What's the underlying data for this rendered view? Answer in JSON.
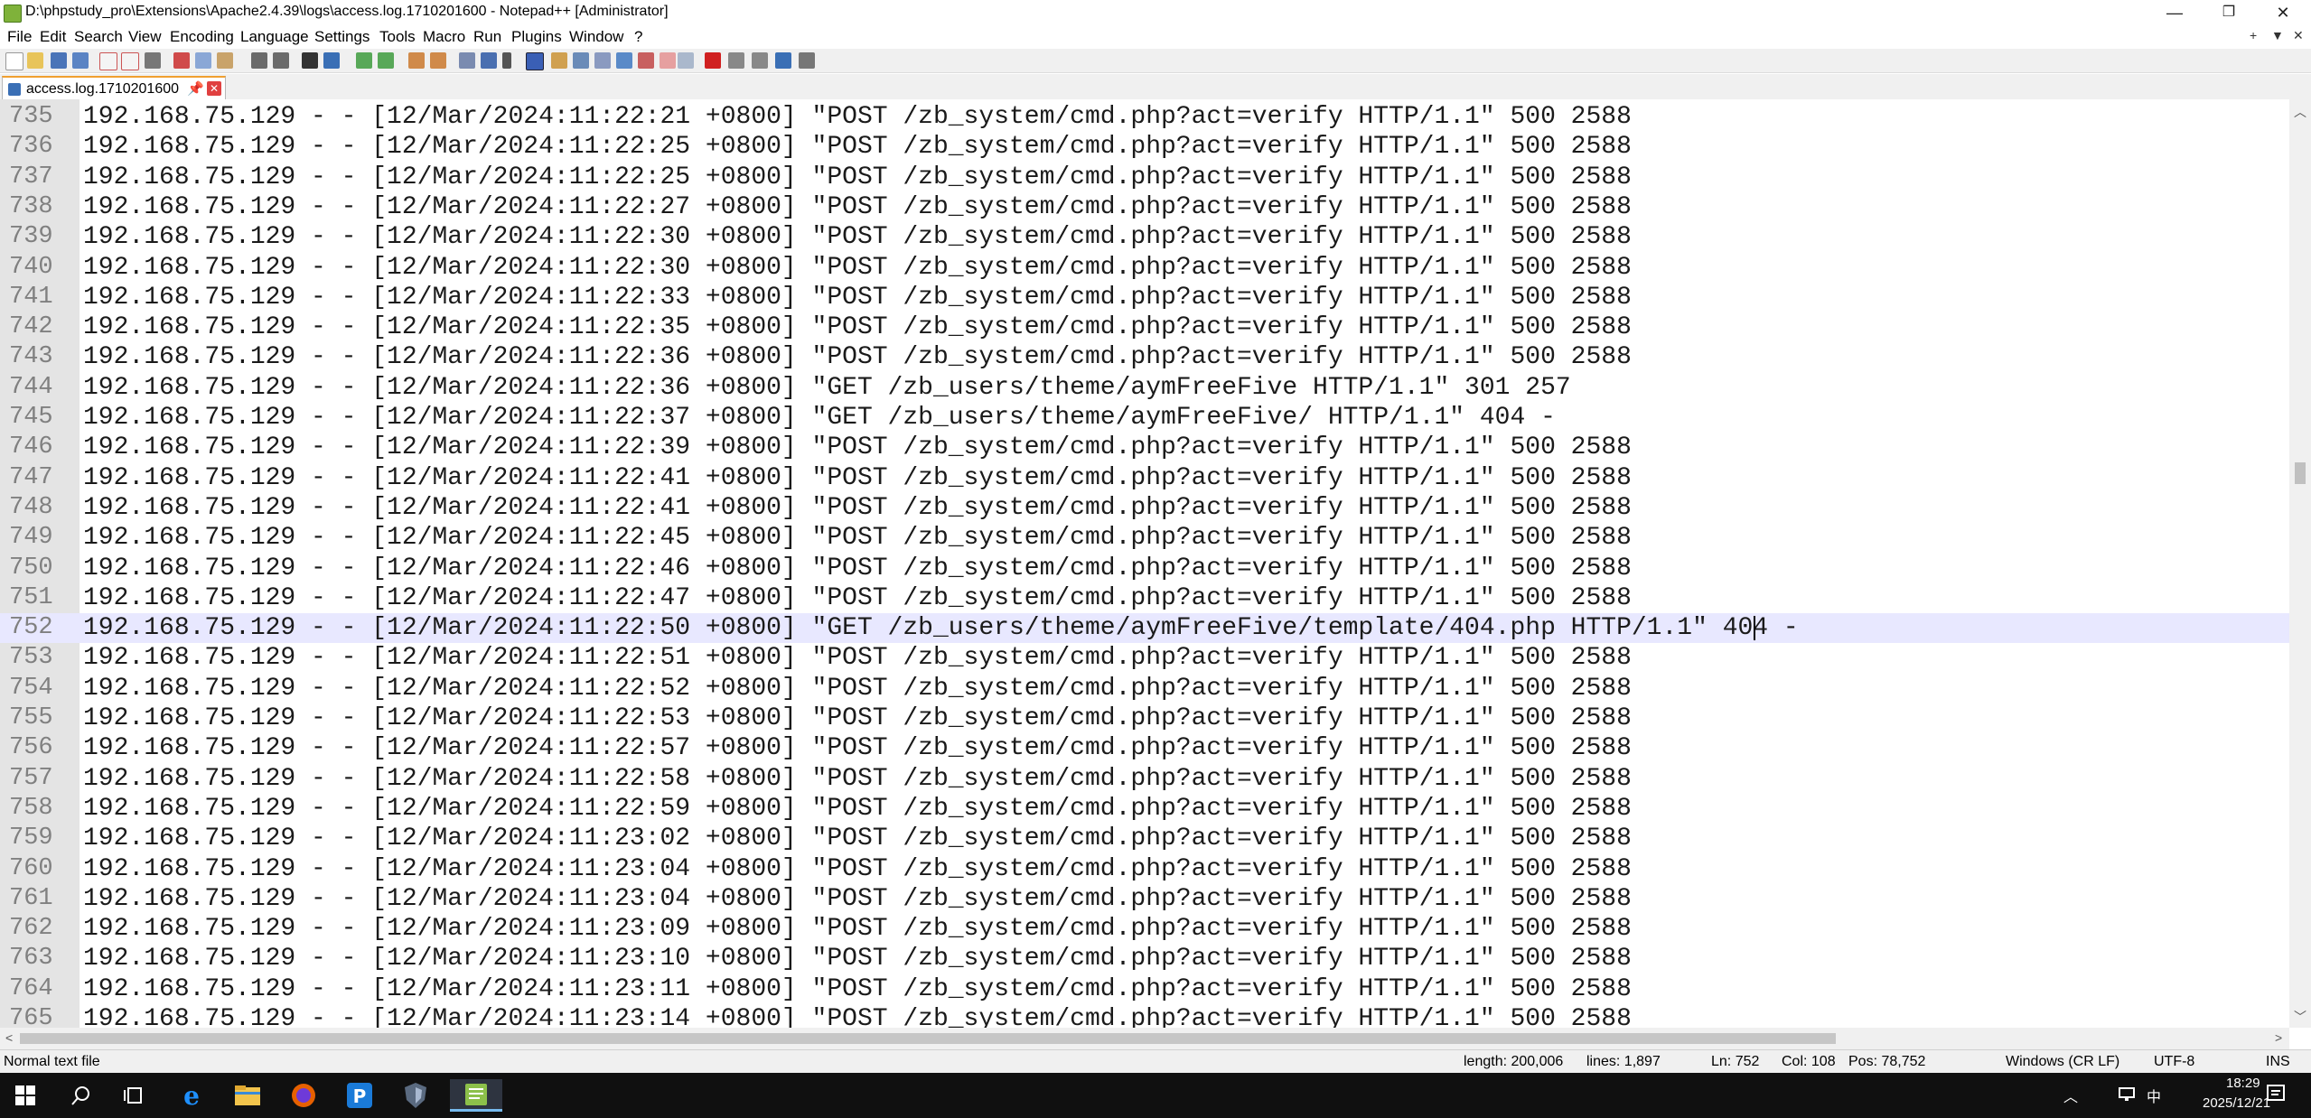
{
  "window": {
    "title": "D:\\phpstudy_pro\\Extensions\\Apache2.4.39\\logs\\access.log.1710201600 - Notepad++ [Administrator]",
    "minimize_glyph": "—",
    "maximize_glyph": "❐",
    "close_glyph": "✕"
  },
  "menu": {
    "items": [
      "File",
      "Edit",
      "Search",
      "View",
      "Encoding",
      "Language",
      "Settings",
      "Tools",
      "Macro",
      "Run",
      "Plugins",
      "Window",
      "?"
    ],
    "right_plus": "+",
    "right_dropdown": "▼",
    "right_close": "✕"
  },
  "tab": {
    "label": "access.log.1710201600",
    "pin_glyph": "📌",
    "close_glyph": "✕"
  },
  "editor": {
    "current_line": 752,
    "lines": [
      {
        "num": "735",
        "text": "192.168.75.129 - - [12/Mar/2024:11:22:21 +0800] \"POST /zb_system/cmd.php?act=verify HTTP/1.1\" 500 2588"
      },
      {
        "num": "736",
        "text": "192.168.75.129 - - [12/Mar/2024:11:22:25 +0800] \"POST /zb_system/cmd.php?act=verify HTTP/1.1\" 500 2588"
      },
      {
        "num": "737",
        "text": "192.168.75.129 - - [12/Mar/2024:11:22:25 +0800] \"POST /zb_system/cmd.php?act=verify HTTP/1.1\" 500 2588"
      },
      {
        "num": "738",
        "text": "192.168.75.129 - - [12/Mar/2024:11:22:27 +0800] \"POST /zb_system/cmd.php?act=verify HTTP/1.1\" 500 2588"
      },
      {
        "num": "739",
        "text": "192.168.75.129 - - [12/Mar/2024:11:22:30 +0800] \"POST /zb_system/cmd.php?act=verify HTTP/1.1\" 500 2588"
      },
      {
        "num": "740",
        "text": "192.168.75.129 - - [12/Mar/2024:11:22:30 +0800] \"POST /zb_system/cmd.php?act=verify HTTP/1.1\" 500 2588"
      },
      {
        "num": "741",
        "text": "192.168.75.129 - - [12/Mar/2024:11:22:33 +0800] \"POST /zb_system/cmd.php?act=verify HTTP/1.1\" 500 2588"
      },
      {
        "num": "742",
        "text": "192.168.75.129 - - [12/Mar/2024:11:22:35 +0800] \"POST /zb_system/cmd.php?act=verify HTTP/1.1\" 500 2588"
      },
      {
        "num": "743",
        "text": "192.168.75.129 - - [12/Mar/2024:11:22:36 +0800] \"POST /zb_system/cmd.php?act=verify HTTP/1.1\" 500 2588"
      },
      {
        "num": "744",
        "text": "192.168.75.129 - - [12/Mar/2024:11:22:36 +0800] \"GET /zb_users/theme/aymFreeFive HTTP/1.1\" 301 257"
      },
      {
        "num": "745",
        "text": "192.168.75.129 - - [12/Mar/2024:11:22:37 +0800] \"GET /zb_users/theme/aymFreeFive/ HTTP/1.1\" 404 -"
      },
      {
        "num": "746",
        "text": "192.168.75.129 - - [12/Mar/2024:11:22:39 +0800] \"POST /zb_system/cmd.php?act=verify HTTP/1.1\" 500 2588"
      },
      {
        "num": "747",
        "text": "192.168.75.129 - - [12/Mar/2024:11:22:41 +0800] \"POST /zb_system/cmd.php?act=verify HTTP/1.1\" 500 2588"
      },
      {
        "num": "748",
        "text": "192.168.75.129 - - [12/Mar/2024:11:22:41 +0800] \"POST /zb_system/cmd.php?act=verify HTTP/1.1\" 500 2588"
      },
      {
        "num": "749",
        "text": "192.168.75.129 - - [12/Mar/2024:11:22:45 +0800] \"POST /zb_system/cmd.php?act=verify HTTP/1.1\" 500 2588"
      },
      {
        "num": "750",
        "text": "192.168.75.129 - - [12/Mar/2024:11:22:46 +0800] \"POST /zb_system/cmd.php?act=verify HTTP/1.1\" 500 2588"
      },
      {
        "num": "751",
        "text": "192.168.75.129 - - [12/Mar/2024:11:22:47 +0800] \"POST /zb_system/cmd.php?act=verify HTTP/1.1\" 500 2588"
      },
      {
        "num": "752",
        "text": "192.168.75.129 - - [12/Mar/2024:11:22:50 +0800] \"GET /zb_users/theme/aymFreeFive/template/404.php HTTP/1.1\" 404 -"
      },
      {
        "num": "753",
        "text": "192.168.75.129 - - [12/Mar/2024:11:22:51 +0800] \"POST /zb_system/cmd.php?act=verify HTTP/1.1\" 500 2588"
      },
      {
        "num": "754",
        "text": "192.168.75.129 - - [12/Mar/2024:11:22:52 +0800] \"POST /zb_system/cmd.php?act=verify HTTP/1.1\" 500 2588"
      },
      {
        "num": "755",
        "text": "192.168.75.129 - - [12/Mar/2024:11:22:53 +0800] \"POST /zb_system/cmd.php?act=verify HTTP/1.1\" 500 2588"
      },
      {
        "num": "756",
        "text": "192.168.75.129 - - [12/Mar/2024:11:22:57 +0800] \"POST /zb_system/cmd.php?act=verify HTTP/1.1\" 500 2588"
      },
      {
        "num": "757",
        "text": "192.168.75.129 - - [12/Mar/2024:11:22:58 +0800] \"POST /zb_system/cmd.php?act=verify HTTP/1.1\" 500 2588"
      },
      {
        "num": "758",
        "text": "192.168.75.129 - - [12/Mar/2024:11:22:59 +0800] \"POST /zb_system/cmd.php?act=verify HTTP/1.1\" 500 2588"
      },
      {
        "num": "759",
        "text": "192.168.75.129 - - [12/Mar/2024:11:23:02 +0800] \"POST /zb_system/cmd.php?act=verify HTTP/1.1\" 500 2588"
      },
      {
        "num": "760",
        "text": "192.168.75.129 - - [12/Mar/2024:11:23:04 +0800] \"POST /zb_system/cmd.php?act=verify HTTP/1.1\" 500 2588"
      },
      {
        "num": "761",
        "text": "192.168.75.129 - - [12/Mar/2024:11:23:04 +0800] \"POST /zb_system/cmd.php?act=verify HTTP/1.1\" 500 2588"
      },
      {
        "num": "762",
        "text": "192.168.75.129 - - [12/Mar/2024:11:23:09 +0800] \"POST /zb_system/cmd.php?act=verify HTTP/1.1\" 500 2588"
      },
      {
        "num": "763",
        "text": "192.168.75.129 - - [12/Mar/2024:11:23:10 +0800] \"POST /zb_system/cmd.php?act=verify HTTP/1.1\" 500 2588"
      },
      {
        "num": "764",
        "text": "192.168.75.129 - - [12/Mar/2024:11:23:11 +0800] \"POST /zb_system/cmd.php?act=verify HTTP/1.1\" 500 2588"
      },
      {
        "num": "765",
        "text": "192.168.75.129 - - [12/Mar/2024:11:23:14 +0800] \"POST /zb_system/cmd.php?act=verify HTTP/1.1\" 500 2588"
      }
    ]
  },
  "status": {
    "file_type": "Normal text file",
    "length": "length: 200,006",
    "lines": "lines: 1,897",
    "ln": "Ln: 752",
    "col": "Col: 108",
    "pos": "Pos: 78,752",
    "eol": "Windows (CR LF)",
    "encoding": "UTF-8",
    "mode": "INS"
  },
  "taskbar": {
    "ime": "中",
    "time": "18:29",
    "date": "2025/12/21"
  },
  "colors": {
    "current_line_bg": "#e8e8ff",
    "gutter_bg": "#e4e4e4",
    "line_number": "#808080",
    "taskbar_bg": "#101010"
  }
}
